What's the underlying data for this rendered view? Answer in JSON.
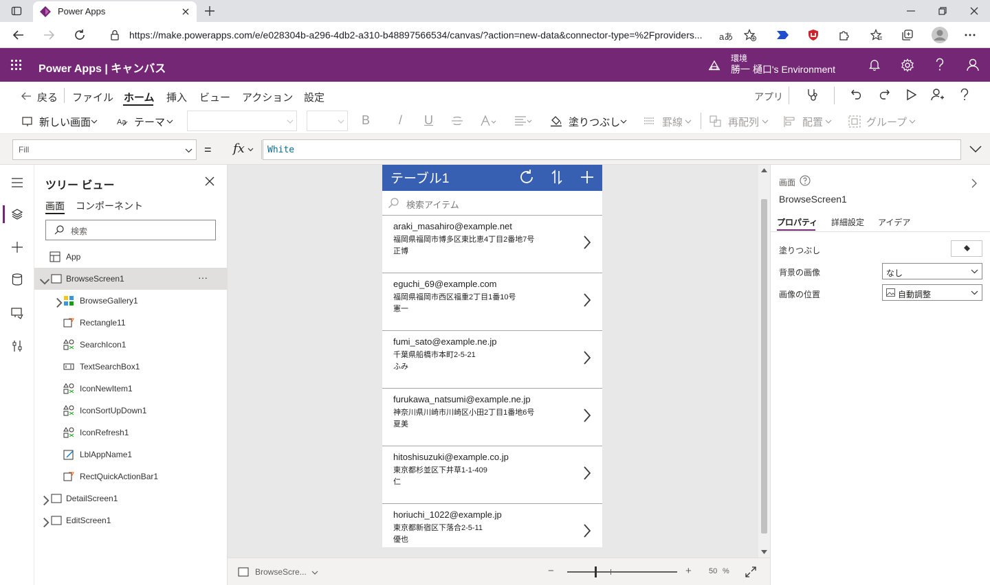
{
  "browser": {
    "tab_title": "Power Apps",
    "url": "https://make.powerapps.com/e/e028304b-a296-4db2-a310-b48897566534/canvas/?action=new-data&connector-type=%2Fproviders...",
    "read_aloud_glyph": "aあ"
  },
  "header": {
    "app_title": "Power Apps | キャンバス",
    "env_label": "環境",
    "env_name": "勝一 樋口's Environment"
  },
  "menu": {
    "back": "戻る",
    "items": [
      "ファイル",
      "ホーム",
      "挿入",
      "ビュー",
      "アクション",
      "設定"
    ],
    "active": "ホーム",
    "app_label": "アプリ"
  },
  "toolbar": {
    "new_screen": "新しい画面",
    "theme": "テーマ",
    "bold": "B",
    "italic": "/",
    "underline": "U",
    "fill": "塗りつぶし",
    "border": "罫線",
    "reorder": "再配列",
    "align": "配置",
    "group": "グループ"
  },
  "formula": {
    "property": "Fill",
    "equals": "=",
    "fx": "fx",
    "value": "White"
  },
  "tree": {
    "title": "ツリー ビュー",
    "tabs": [
      "画面",
      "コンポーネント"
    ],
    "search_placeholder": "検索",
    "app": "App",
    "screen": "BrowseScreen1",
    "children": [
      "BrowseGallery1",
      "Rectangle11",
      "SearchIcon1",
      "TextSearchBox1",
      "IconNewItem1",
      "IconSortUpDown1",
      "IconRefresh1",
      "LblAppName1",
      "RectQuickActionBar1"
    ],
    "other_screens": [
      "DetailScreen1",
      "EditScreen1"
    ],
    "more": "···"
  },
  "phone": {
    "title": "テーブル1",
    "search_placeholder": "検索アイテム",
    "items": [
      {
        "email": "araki_masahiro@example.net",
        "address": "福岡県福岡市博多区東比恵4丁目2番地7号",
        "name": "正博"
      },
      {
        "email": "eguchi_69@example.com",
        "address": "福岡県福岡市西区福重2丁目1番10号",
        "name": "憲一"
      },
      {
        "email": "fumi_sato@example.ne.jp",
        "address": "千葉県船橋市本町2-5-21",
        "name": "ふみ"
      },
      {
        "email": "furukawa_natsumi@example.ne.jp",
        "address": "神奈川県川崎市川崎区小田2丁目1番地6号",
        "name": "夏美"
      },
      {
        "email": "hitoshisuzuki@example.co.jp",
        "address": "東京都杉並区下井草1-1-409",
        "name": "仁"
      },
      {
        "email": "horiuchi_1022@example.jp",
        "address": "東京都新宿区下落合2-5-11",
        "name": "優也"
      }
    ]
  },
  "bottom": {
    "screen": "BrowseScre...",
    "minus": "−",
    "plus": "+",
    "zoom": "50",
    "zoom_unit": "%"
  },
  "panel": {
    "type": "画面",
    "name": "BrowseScreen1",
    "tabs": [
      "プロパティ",
      "詳細設定",
      "アイデア"
    ],
    "fill_label": "塗りつぶし",
    "bg_image_label": "背景の画像",
    "bg_image_value": "なし",
    "image_pos_label": "画像の位置",
    "image_pos_value": "自動調整"
  },
  "colors": {
    "header": "#742774",
    "phone_header": "#3860b2",
    "selected_row": "#e1dfdd"
  }
}
